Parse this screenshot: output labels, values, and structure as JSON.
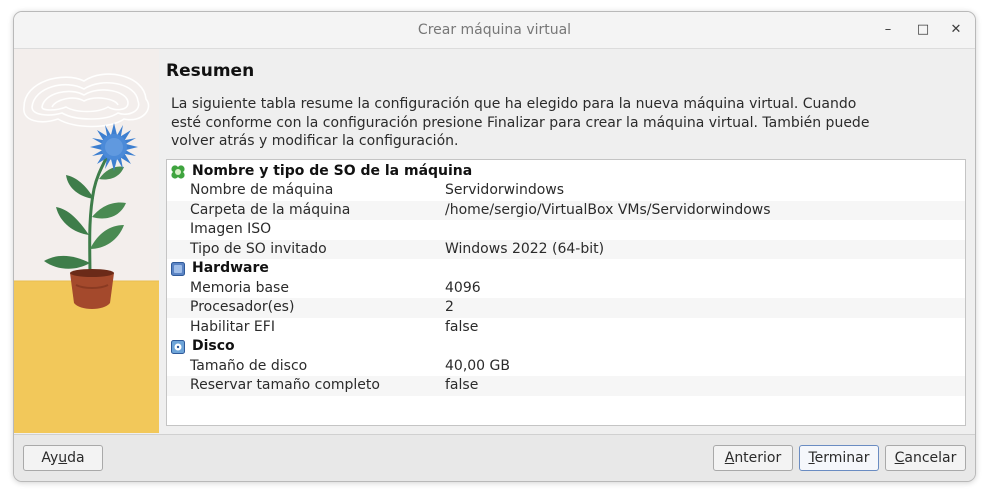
{
  "window": {
    "title": "Crear máquina virtual",
    "controls": {
      "minimize": "–",
      "maximize": "□",
      "close": "✕"
    }
  },
  "page": {
    "heading": "Resumen",
    "description": "La siguiente tabla resume la configuración que ha elegido para la nueva máquina virtual. Cuando esté conforme con la configuración presione Finalizar para crear la máquina virtual. También puede volver atrás y modificar la configuración."
  },
  "summary": {
    "groups": [
      {
        "title": "Nombre y tipo de SO de la máquina",
        "icon": "puzzle-icon",
        "rows": [
          {
            "key": "Nombre de máquina",
            "value": "Servidorwindows"
          },
          {
            "key": "Carpeta de la máquina",
            "value": "/home/sergio/VirtualBox VMs/Servidorwindows"
          },
          {
            "key": "Imagen ISO",
            "value": ""
          },
          {
            "key": "Tipo de SO invitado",
            "value": "Windows 2022 (64-bit)"
          }
        ]
      },
      {
        "title": "Hardware",
        "icon": "chip-icon",
        "rows": [
          {
            "key": "Memoria base",
            "value": "4096"
          },
          {
            "key": "Procesador(es)",
            "value": "2"
          },
          {
            "key": "Habilitar EFI",
            "value": "false"
          }
        ]
      },
      {
        "title": "Disco",
        "icon": "disk-icon",
        "rows": [
          {
            "key": "Tamaño de disco",
            "value": "40,00 GB"
          },
          {
            "key": "Reservar tamaño completo",
            "value": "false"
          }
        ]
      }
    ]
  },
  "footer": {
    "help": {
      "pre": "Ay",
      "mnemonic": "u",
      "post": "da"
    },
    "back": {
      "pre": "",
      "mnemonic": "A",
      "post": "nterior"
    },
    "finish": {
      "pre": "",
      "mnemonic": "T",
      "post": "erminar"
    },
    "cancel": {
      "pre": "",
      "mnemonic": "C",
      "post": "ancelar"
    }
  },
  "colors": {
    "accent": "#6a8cc2",
    "flower": "#3d7fd0",
    "floor": "#f2c85a",
    "pot": "#a4492c",
    "leaf": "#3e7d4a"
  }
}
